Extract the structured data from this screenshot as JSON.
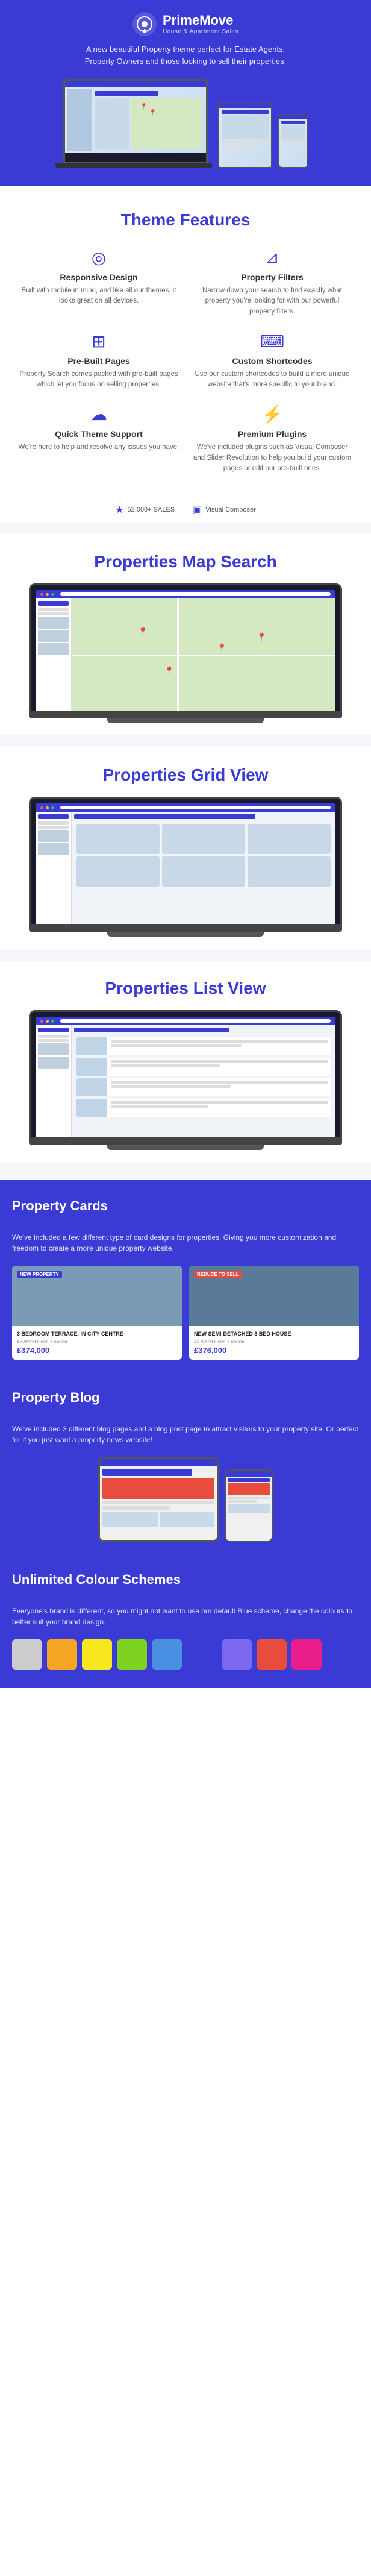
{
  "header": {
    "logo_title": "PrimeMove",
    "logo_subtitle": "House & Apartment Sales",
    "description": "A new beautiful Property theme perfect for Estate Agents, Property Owners and those looking to sell their properties."
  },
  "theme_features": {
    "section_title": "Theme Features",
    "features": [
      {
        "id": "responsive-design",
        "icon": "◎",
        "title": "Responsive Design",
        "desc": "Built with mobile in mind, and like all our themes, it looks great on all devices."
      },
      {
        "id": "property-filters",
        "icon": "⊿",
        "title": "Property Filters",
        "desc": "Narrow down your search to find exactly what property you're looking for with our powerful property filters."
      },
      {
        "id": "pre-built-pages",
        "icon": "⊞",
        "title": "Pre-Built Pages",
        "desc": "Property Search comes packed with pre-built pages which let you focus on selling properties."
      },
      {
        "id": "custom-shortcodes",
        "icon": "⌨",
        "title": "Custom Shortcodes",
        "desc": "Use our custom shortcodes to build a more unique website that's more specific to your brand."
      },
      {
        "id": "quick-theme-support",
        "icon": "☁",
        "title": "Quick Theme Support",
        "desc": "We're here to help and resolve any issues you have."
      },
      {
        "id": "premium-plugins",
        "icon": "⚡",
        "title": "Premium Plugins",
        "desc": "We've included plugins such as Visual Composer and Slider Revolution to help you build your custom pages or edit our pre-built ones."
      }
    ]
  },
  "badges": [
    {
      "id": "sales-count",
      "icon": "★",
      "text": "52,000+ SALES"
    },
    {
      "id": "visual-composer",
      "icon": "▣",
      "text": "Visual Composer"
    }
  ],
  "properties_map": {
    "section_title": "Properties Map Search"
  },
  "properties_grid": {
    "section_title": "Properties Grid View"
  },
  "properties_list": {
    "section_title": "Properties List View"
  },
  "property_cards": {
    "section_title": "Property Cards",
    "description": "We've included a few different type of card designs for properties. Giving you more customization and freedom to create a more unique property website.",
    "cards": [
      {
        "id": "card-1",
        "badge": "NEW PROPERTY",
        "badge_type": "primary",
        "title": "3 BEDROOM TERRACE, IN CITY CENTRE",
        "address": "43 Alfred Drive, London",
        "price": "£374,000"
      },
      {
        "id": "card-2",
        "badge": "REDUCE TO SELL",
        "badge_type": "danger",
        "title": "NEW SEMI-DETACHED 3 BED HOUSE",
        "address": "42 Alfred Drive, London",
        "price": "£376,000"
      }
    ]
  },
  "property_blog": {
    "section_title": "Property Blog",
    "description": "We've included 3 different blog pages and a blog post page to attract visitors to your property site. Or perfect for if you just want a property news website!"
  },
  "colour_schemes": {
    "section_title": "Unlimited Colour Schemes",
    "description": "Everyone's brand is different, so you might not want to use our default Blue scheme, change the colours to better suit your brand design.",
    "swatches": [
      "#cccccc",
      "#f5a623",
      "#f8e71c",
      "#7ed321",
      "#4a90e2",
      "#3a3ad4",
      "#7b68ee",
      "#e74c3c",
      "#e91e8c"
    ]
  }
}
